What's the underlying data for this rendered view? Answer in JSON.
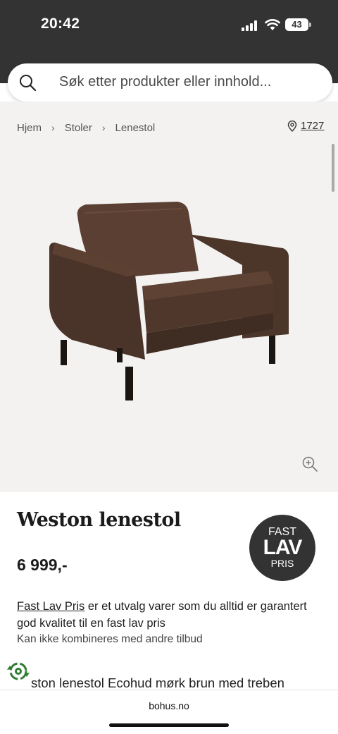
{
  "status_bar": {
    "time": "20:42",
    "battery": "43"
  },
  "search": {
    "placeholder": "Søk etter produkter eller innhold..."
  },
  "breadcrumb": {
    "items": [
      "Hjem",
      "Stoler",
      "Lenestol"
    ]
  },
  "store": {
    "code": "1727"
  },
  "product": {
    "title": "Weston lenestol",
    "price": "6 999,-",
    "badge": {
      "line1": "FAST",
      "line2": "LAV",
      "line3": "PRIS"
    },
    "program_link": "Fast Lav Pris",
    "program_text": " er et utvalg varer som du alltid er garantert god kvalitet til en fast lav pris",
    "note": "Kan ikke kombineres med andre tilbud",
    "description_cutoff": "ston lenestol Ecohud mørk brun med treben"
  },
  "browser": {
    "url": "bohus.no"
  },
  "icons": {
    "search": "search-icon",
    "chevron": "chevron-right-icon",
    "store": "location-pin-icon",
    "zoom": "zoom-in-icon",
    "eco": "recycle-leaf-icon"
  },
  "colors": {
    "header_bg": "#333333",
    "gallery_bg": "#f3f2f0",
    "badge_bg": "#333333"
  }
}
